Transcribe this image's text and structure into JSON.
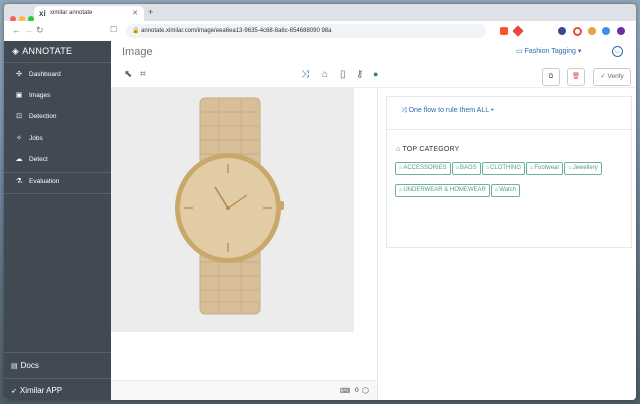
{
  "browser": {
    "tab_title": "ximilar annotate",
    "tab_favicon": "xi",
    "url": "annotate.ximilar.com/image/eea6ea13-9635-4c68-8a6c-654688090 98a"
  },
  "sidebar": {
    "brand": "ANNOTATE",
    "items": [
      {
        "label": "Dashboard",
        "icon": "dashboard-icon"
      },
      {
        "label": "Images",
        "icon": "images-icon"
      },
      {
        "label": "Detection",
        "icon": "detection-icon"
      },
      {
        "label": "Jobs",
        "icon": "jobs-icon"
      },
      {
        "label": "Detect",
        "icon": "detect-icon"
      },
      {
        "label": "Evaluation",
        "icon": "evaluation-icon"
      }
    ],
    "docs": "Docs",
    "app": "Ximilar APP"
  },
  "header": {
    "title": "Image",
    "workspace": "Fashion Tagging"
  },
  "actions": {
    "verify": "Verify"
  },
  "panel": {
    "flow": "One flow to rule them ALL",
    "category_title": "TOP CATEGORY",
    "tags": [
      "ACCESSORIES",
      "BAGS",
      "CLOTHING",
      "Footwear",
      "Jewellery",
      "UNDERWEAR & HOMEWEAR",
      "Watch"
    ]
  },
  "status": {
    "object_count": "0"
  },
  "colors": {
    "sidebar": "#414a52",
    "accent": "#2b6cb0",
    "tag": "#5a9c84",
    "watch_wood": "#e0c9a4"
  }
}
